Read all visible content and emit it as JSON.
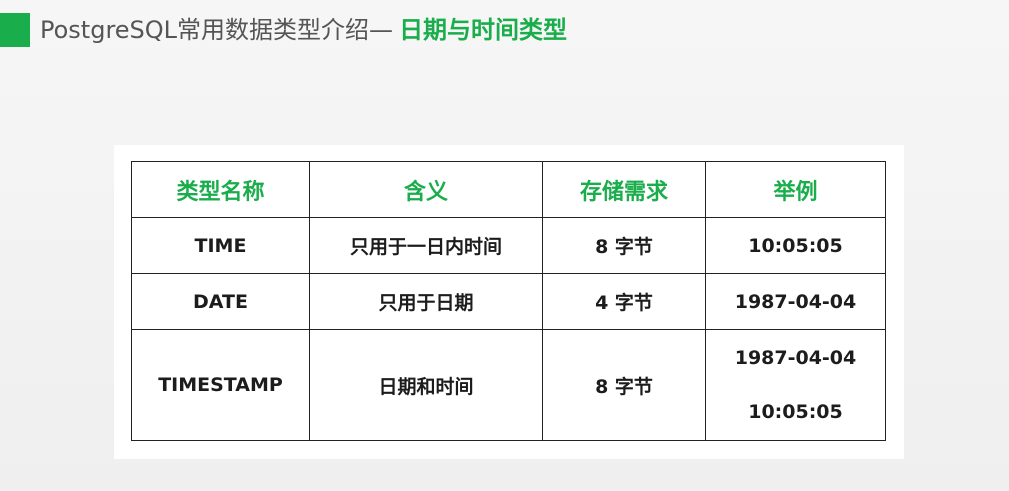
{
  "header": {
    "title_plain": "PostgreSQL常用数据类型介绍—",
    "title_highlight": "日期与时间类型",
    "accent_color": "#1aad4b"
  },
  "table": {
    "headers": [
      "类型名称",
      "含义",
      "存储需求",
      "举例"
    ],
    "rows": [
      {
        "name": "TIME",
        "meaning": "只用于一日内时间",
        "storage": "8 字节",
        "example": [
          "10:05:05"
        ]
      },
      {
        "name": "DATE",
        "meaning": "只用于日期",
        "storage": "4 字节",
        "example": [
          "1987-04-04"
        ]
      },
      {
        "name": "TIMESTAMP",
        "meaning": "日期和时间",
        "storage": "8 字节",
        "example": [
          "1987-04-04",
          "10:05:05"
        ]
      }
    ]
  }
}
